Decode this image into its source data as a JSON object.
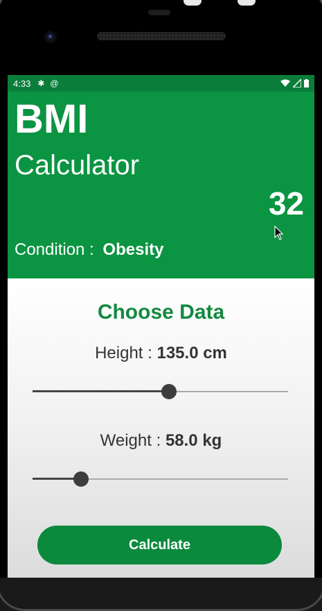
{
  "status_bar": {
    "time": "4:33",
    "icons_left": [
      "gear-icon",
      "at-sync-icon"
    ],
    "icons_right": [
      "wifi-icon",
      "signal-icon",
      "battery-icon"
    ]
  },
  "header": {
    "title": "BMI",
    "subtitle": "Calculator",
    "bmi_value": "32",
    "condition_label": "Condition :",
    "condition_value": "Obesity"
  },
  "form": {
    "section_title": "Choose Data",
    "height_label": "Height :",
    "height_value": "135.0 cm",
    "height_slider_fraction": 0.535,
    "weight_label": "Weight :",
    "weight_value": "58.0 kg",
    "weight_slider_fraction": 0.19,
    "calculate_label": "Calculate"
  },
  "colors": {
    "brand_green": "#0b9442",
    "status_green": "#0b7d3a",
    "accent_green": "#13893f"
  }
}
